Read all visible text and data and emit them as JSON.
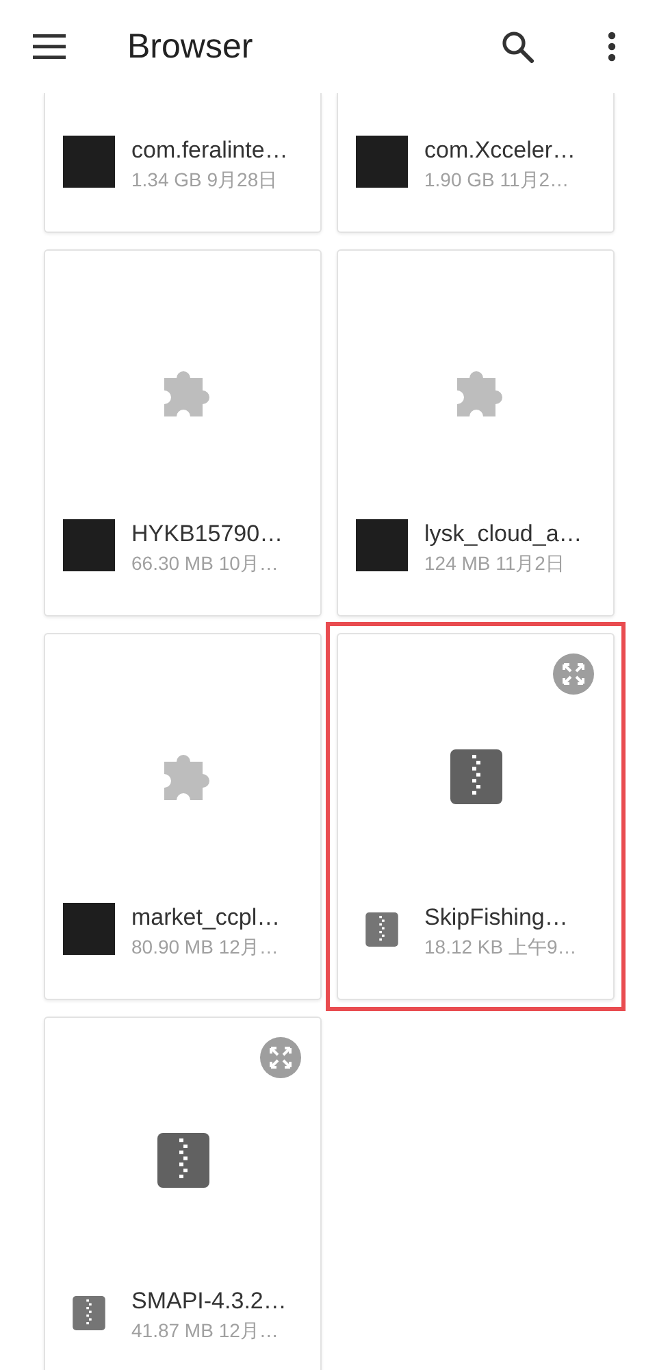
{
  "app_bar": {
    "title": "Browser"
  },
  "items": [
    {
      "kind": "apk",
      "name": "com.feralinte…",
      "details": "1.34 GB 9月28日",
      "highlighted": false,
      "top_cut_off": true
    },
    {
      "kind": "apk",
      "name": "com.Xcceler…",
      "details": "1.90 GB 11月2…",
      "highlighted": false,
      "top_cut_off": true
    },
    {
      "kind": "apk",
      "name": "HYKB15790…",
      "details": "66.30 MB 10月…",
      "highlighted": false,
      "top_cut_off": false
    },
    {
      "kind": "apk",
      "name": "lysk_cloud_a…",
      "details": "124 MB 11月2日",
      "highlighted": false,
      "top_cut_off": false
    },
    {
      "kind": "apk",
      "name": "market_ccpl…",
      "details": "80.90 MB 12月…",
      "highlighted": false,
      "top_cut_off": false
    },
    {
      "kind": "zip",
      "name": "SkipFishing…",
      "details": "18.12 KB 上午9…",
      "highlighted": true,
      "top_cut_off": false
    },
    {
      "kind": "zip",
      "name": "SMAPI-4.3.2…",
      "details": "41.87 MB 12月…",
      "highlighted": false,
      "top_cut_off": false
    }
  ]
}
